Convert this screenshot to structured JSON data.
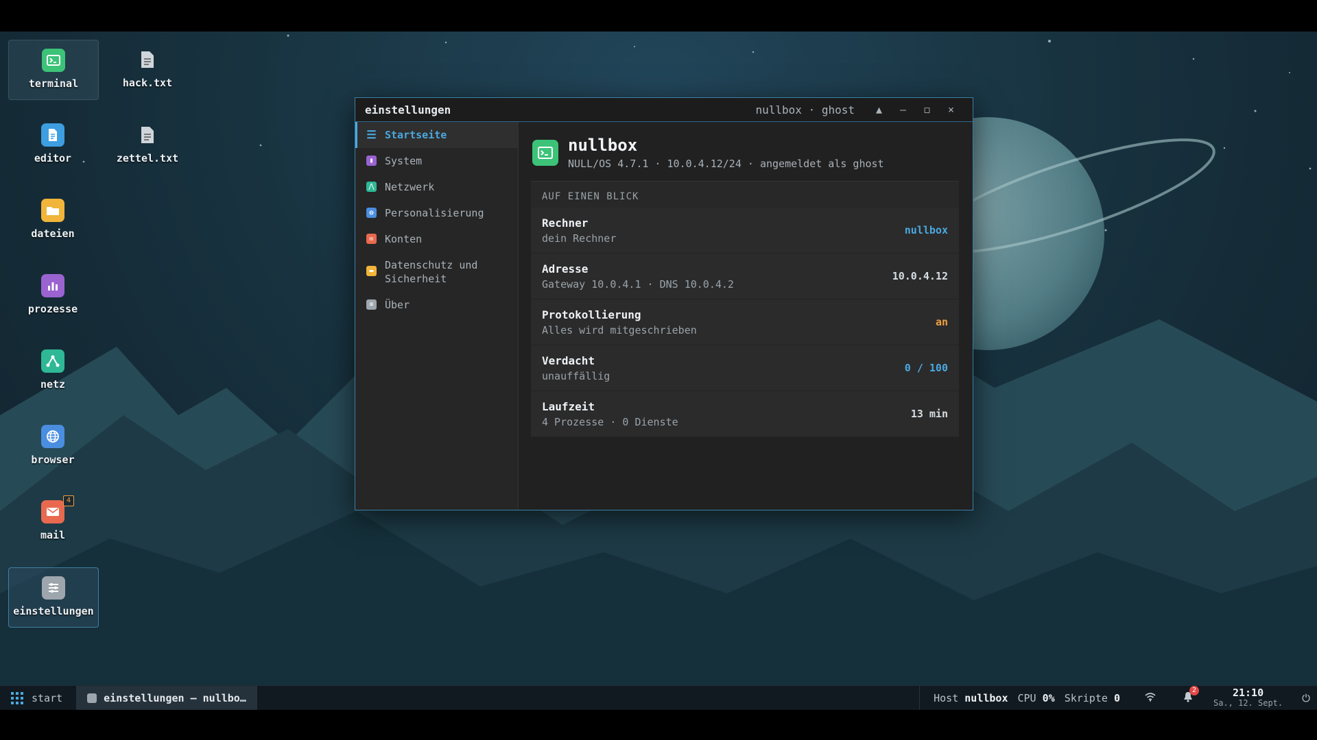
{
  "desktop": {
    "icons": [
      {
        "label": "terminal",
        "icon": "terminal-icon",
        "color": "#3cc378"
      },
      {
        "label": "hack.txt",
        "icon": "text-file-icon",
        "color": "#cfd5da"
      },
      {
        "label": "editor",
        "icon": "document-icon",
        "color": "#3d9ee0"
      },
      {
        "label": "zettel.txt",
        "icon": "text-file-icon",
        "color": "#cfd5da"
      },
      {
        "label": "dateien",
        "icon": "folder-icon",
        "color": "#f0b53a"
      },
      {
        "label": "prozesse",
        "icon": "bar-chart-icon",
        "color": "#9a63d0"
      },
      {
        "label": "netz",
        "icon": "network-icon",
        "color": "#2fb896"
      },
      {
        "label": "browser",
        "icon": "globe-icon",
        "color": "#4a8ee0"
      },
      {
        "label": "mail",
        "icon": "mail-icon",
        "color": "#e8694f",
        "badge": "4"
      },
      {
        "label": "einstellungen",
        "icon": "settings-icon",
        "color": "#9ea6ad"
      }
    ]
  },
  "window": {
    "title": "einstellungen",
    "host_label": "nullbox · ghost",
    "buttons": {
      "up": "▲",
      "minimize": "–",
      "maximize": "◻",
      "close": "×"
    },
    "sidebar": [
      {
        "label": "Startseite",
        "icon": "list-icon",
        "color": "#4aa8e0",
        "active": true
      },
      {
        "label": "System",
        "icon": "bar-chart-icon",
        "color": "#9a63d0"
      },
      {
        "label": "Netzwerk",
        "icon": "network-icon",
        "color": "#2fb896"
      },
      {
        "label": "Personalisierung",
        "icon": "globe-icon",
        "color": "#4a8ee0"
      },
      {
        "label": "Konten",
        "icon": "mail-icon",
        "color": "#e8694f"
      },
      {
        "label": "Datenschutz und Sicherheit",
        "icon": "folder-icon",
        "color": "#f0b53a"
      },
      {
        "label": "Über",
        "icon": "settings-icon",
        "color": "#9ea6ad"
      }
    ],
    "main": {
      "name": "nullbox",
      "subtitle": "NULL/OS 4.7.1 · 10.0.4.12/24 · angemeldet als ghost",
      "glance_heading": "AUF EINEN BLICK",
      "rows": [
        {
          "title": "Rechner",
          "sub": "dein Rechner",
          "value": "nullbox",
          "color": "#4aa8e0"
        },
        {
          "title": "Adresse",
          "sub": "Gateway 10.0.4.1 · DNS 10.0.4.2",
          "value": "10.0.4.12",
          "color": "#d7dde2"
        },
        {
          "title": "Protokollierung",
          "sub": "Alles wird mitgeschrieben",
          "value": "an",
          "color": "#f0a040"
        },
        {
          "title": "Verdacht",
          "sub": "unauffällig",
          "value": "0 / 100",
          "color": "#4aa8e0"
        },
        {
          "title": "Laufzeit",
          "sub": "4 Prozesse · 0 Dienste",
          "value": "13 min",
          "color": "#d7dde2"
        }
      ]
    }
  },
  "taskbar": {
    "start_label": "start",
    "task_label": "einstellungen — nullbo…",
    "host_label": "Host",
    "host_value": "nullbox",
    "cpu_label": "CPU",
    "cpu_value": "0%",
    "scripts_label": "Skripte",
    "scripts_value": "0",
    "notification_count": "2",
    "time": "21:10",
    "date": "Sa., 12. Sept."
  }
}
